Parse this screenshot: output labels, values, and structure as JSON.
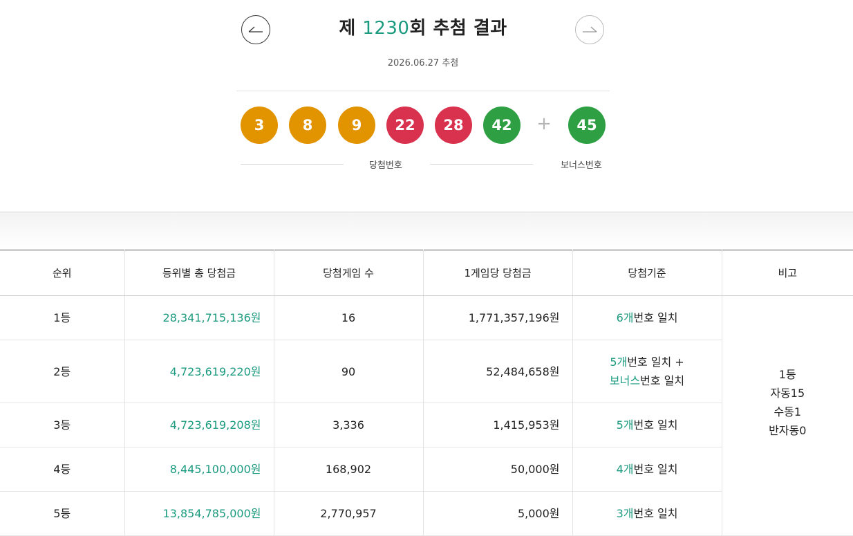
{
  "header": {
    "title_prefix": "제 ",
    "round_number": "1230",
    "title_suffix": "회 추첨 결과",
    "draw_date": "2026.06.27 추첨"
  },
  "balls": [
    {
      "number": "3",
      "color": "#e29300"
    },
    {
      "number": "8",
      "color": "#e29300"
    },
    {
      "number": "9",
      "color": "#e29300"
    },
    {
      "number": "22",
      "color": "#d9324f"
    },
    {
      "number": "28",
      "color": "#d9324f"
    },
    {
      "number": "42",
      "color": "#2ea043"
    }
  ],
  "plus_sign": "+",
  "bonus_ball": {
    "number": "45",
    "color": "#2ea043"
  },
  "captions": {
    "winning": "당첨번호",
    "bonus": "보너스번호"
  },
  "table": {
    "headers": [
      "순위",
      "등위별 총 당첨금",
      "당첨게임 수",
      "1게임당 당첨금",
      "당첨기준",
      "비고"
    ],
    "rows": [
      {
        "rank": "1등",
        "total_prize": "28,341,715,136원",
        "winners": "16",
        "per_game": "1,771,357,196원",
        "criteria": [
          {
            "green": "6개",
            "dark": "번호 일치"
          }
        ]
      },
      {
        "rank": "2등",
        "total_prize": "4,723,619,220원",
        "winners": "90",
        "per_game": "52,484,658원",
        "criteria": [
          {
            "green": "5개",
            "dark": "번호 일치 +"
          },
          {
            "green": "보너스",
            "dark": "번호 일치"
          }
        ]
      },
      {
        "rank": "3등",
        "total_prize": "4,723,619,208원",
        "winners": "3,336",
        "per_game": "1,415,953원",
        "criteria": [
          {
            "green": "5개",
            "dark": "번호 일치"
          }
        ]
      },
      {
        "rank": "4등",
        "total_prize": "8,445,100,000원",
        "winners": "168,902",
        "per_game": "50,000원",
        "criteria": [
          {
            "green": "4개",
            "dark": "번호 일치"
          }
        ]
      },
      {
        "rank": "5등",
        "total_prize": "13,854,785,000원",
        "winners": "2,770,957",
        "per_game": "5,000원",
        "criteria": [
          {
            "green": "3개",
            "dark": "번호 일치"
          }
        ]
      }
    ],
    "note": [
      "1등",
      "자동15",
      "수동1",
      "반자동0"
    ]
  },
  "icons": {
    "prev": "arrow-left-icon",
    "next": "arrow-right-icon"
  }
}
